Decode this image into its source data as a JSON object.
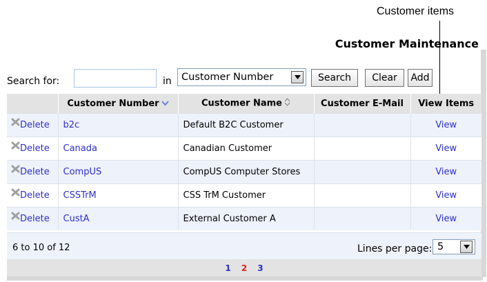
{
  "callout": {
    "text": "Customer items"
  },
  "page": {
    "title": "Customer Maintenance"
  },
  "search": {
    "label": "Search for:",
    "value": "",
    "placeholder": "",
    "in_label": "in",
    "field_selected": "Customer Number",
    "search_button": "Search",
    "clear_button": "Clear",
    "add_button": "Add"
  },
  "table": {
    "columns": [
      "",
      "Customer Number",
      "Customer Name",
      "Customer E-Mail",
      "View Items"
    ],
    "sorted_column": "Customer Number",
    "rows": [
      {
        "action": "Delete",
        "number": "b2c",
        "name": "Default B2C Customer",
        "email": "",
        "view": "View"
      },
      {
        "action": "Delete",
        "number": "Canada",
        "name": "Canadian Customer",
        "email": "",
        "view": "View"
      },
      {
        "action": "Delete",
        "number": "CompUS",
        "name": "CompUS Computer Stores",
        "email": "",
        "view": "View"
      },
      {
        "action": "Delete",
        "number": "CSSTrM",
        "name": "CSS TrM Customer",
        "email": "",
        "view": "View"
      },
      {
        "action": "Delete",
        "number": "CustA",
        "name": "External Customer A",
        "email": "",
        "view": "View"
      }
    ]
  },
  "footer": {
    "count": "6 to 10 of 12",
    "lines_label": "Lines per page:",
    "lines_value": "5"
  },
  "pager": {
    "pages": [
      "1",
      "2",
      "3"
    ],
    "current": "2"
  },
  "colors": {
    "link": "#2e2ec8",
    "current_page": "#e0201a",
    "header_bg": "#e3e3e3",
    "row_alt_bg": "#eef2fb"
  }
}
